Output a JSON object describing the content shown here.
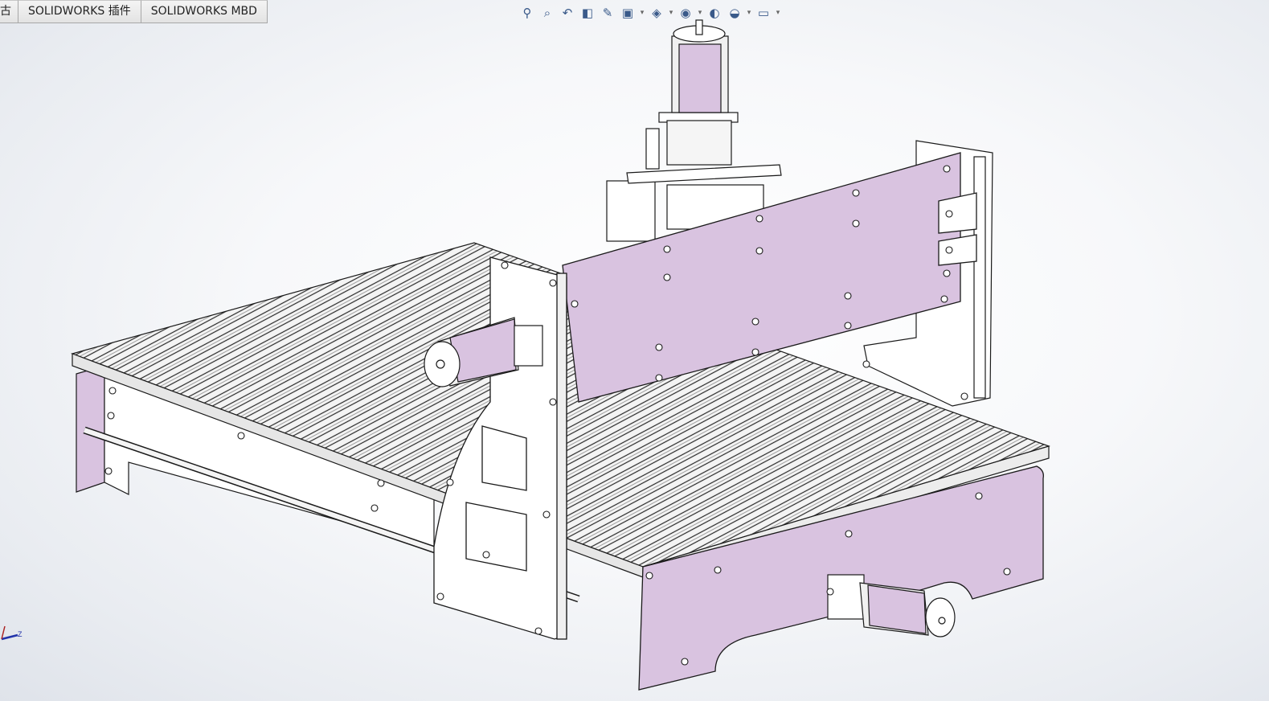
{
  "tabs": [
    {
      "label": "古"
    },
    {
      "label": "SOLIDWORKS 插件"
    },
    {
      "label": "SOLIDWORKS MBD"
    }
  ],
  "toolbar": {
    "icons": [
      {
        "name": "zoom-to-fit-icon",
        "glyph": "⚲"
      },
      {
        "name": "zoom-to-area-icon",
        "glyph": "⌕"
      },
      {
        "name": "previous-view-icon",
        "glyph": "↶"
      },
      {
        "name": "section-view-icon",
        "glyph": "◧"
      },
      {
        "name": "dynamic-annotation-icon",
        "glyph": "✎"
      },
      {
        "name": "view-orientation-icon",
        "glyph": "▣"
      },
      {
        "name": "display-style-icon",
        "glyph": "◈"
      },
      {
        "name": "hide-show-items-icon",
        "glyph": "◉"
      },
      {
        "name": "edit-appearance-icon",
        "glyph": "◐"
      },
      {
        "name": "apply-scene-icon",
        "glyph": "◒"
      },
      {
        "name": "view-settings-icon",
        "glyph": "▭"
      }
    ]
  },
  "triad": {
    "axis_label": "Z"
  },
  "colors": {
    "panel": "#d9c3e0",
    "outline": "#1a1a1a",
    "aluminum": "#f2f2f2"
  }
}
